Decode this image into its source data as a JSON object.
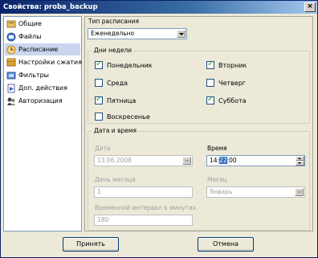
{
  "window": {
    "title": "Свойства: proba_backup"
  },
  "sidebar": {
    "items": [
      {
        "label": "Общие",
        "icon": "general-icon"
      },
      {
        "label": "Файлы",
        "icon": "files-icon"
      },
      {
        "label": "Расписание",
        "icon": "schedule-icon",
        "selected": true
      },
      {
        "label": "Настройки сжатия",
        "icon": "compression-icon"
      },
      {
        "label": "Фильтры",
        "icon": "filters-icon"
      },
      {
        "label": "Доп. действия",
        "icon": "extra-actions-icon"
      },
      {
        "label": "Авторизация",
        "icon": "authorization-icon"
      }
    ]
  },
  "schedule": {
    "type_label": "Тип расписания",
    "type_value": "Еженедельно",
    "days_group": "Дни недели",
    "days": [
      {
        "label": "Понедельник",
        "checked": true
      },
      {
        "label": "Вторник",
        "checked": true
      },
      {
        "label": "Среда",
        "checked": false
      },
      {
        "label": "Четверг",
        "checked": false
      },
      {
        "label": "Пятница",
        "checked": true
      },
      {
        "label": "Суббота",
        "checked": true
      },
      {
        "label": "Воскресенье",
        "checked": false
      }
    ],
    "datetime_group": "Дата и время",
    "date_label": "Дата",
    "date_value": "13.06.2008",
    "time_label": "Время",
    "time_hour": "14",
    "time_sep": ":",
    "time_minute": "22",
    "time_rest": ":00",
    "day_of_month_label": "День месяца",
    "day_of_month_value": "1",
    "month_label": "Месяц",
    "month_value": "Январь",
    "interval_label": "Временной интервал в минутах",
    "interval_value": "180"
  },
  "footer": {
    "accept_label": "Принять",
    "cancel_label": "Отмена"
  },
  "colors": {
    "title_bar": "#0a246a",
    "selection": "#316ac5",
    "check_mark": "#21a121"
  }
}
